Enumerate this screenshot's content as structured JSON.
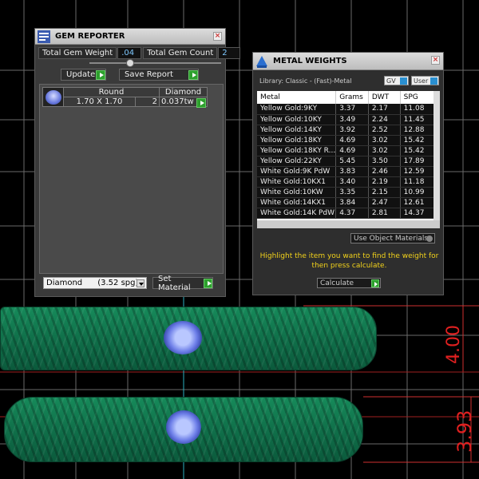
{
  "gem_reporter": {
    "title": "GEM REPORTER",
    "close_glyph": "×",
    "total_weight_label": "Total Gem Weight",
    "total_weight_value": ".04",
    "total_count_label": "Total Gem Count",
    "total_count_value": "2",
    "update_label": "Update",
    "save_report_label": "Save Report",
    "table": {
      "headers": [
        "Round",
        "Diamond"
      ],
      "row": {
        "size": "1.70 X 1.70",
        "count": "2",
        "weight": "0.037tw"
      }
    },
    "material_select": "Diamond      (3.52 spg)",
    "set_material_label": "Set Material"
  },
  "metal_weights": {
    "title": "METAL WEIGHTS",
    "close_glyph": "×",
    "library_text": "Library: Classic - (Fast)-Metal",
    "toggle_gv": "GV",
    "toggle_user": "User",
    "columns": [
      "Metal",
      "Grams",
      "DWT",
      "SPG"
    ],
    "rows": [
      [
        "Yellow Gold:9KY",
        "3.37",
        "2.17",
        "11.08"
      ],
      [
        "Yellow Gold:10KY",
        "3.49",
        "2.24",
        "11.45"
      ],
      [
        "Yellow Gold:14KY",
        "3.92",
        "2.52",
        "12.88"
      ],
      [
        "Yellow Gold:18KY",
        "4.69",
        "3.02",
        "15.42"
      ],
      [
        "Yellow Gold:18KY R...",
        "4.69",
        "3.02",
        "15.42"
      ],
      [
        "Yellow Gold:22KY",
        "5.45",
        "3.50",
        "17.89"
      ],
      [
        "White Gold:9K PdW",
        "3.83",
        "2.46",
        "12.59"
      ],
      [
        "White Gold:10KX1",
        "3.40",
        "2.19",
        "11.18"
      ],
      [
        "White Gold:10KW",
        "3.35",
        "2.15",
        "10.99"
      ],
      [
        "White Gold:14KX1",
        "3.84",
        "2.47",
        "12.61"
      ],
      [
        "White Gold:14K PdW",
        "4.37",
        "2.81",
        "14.37"
      ]
    ],
    "use_object_materials": "Use Object Materials",
    "hint": "Highlight the item you want to find the weight for then press calculate.",
    "calculate_label": "Calculate"
  },
  "viewport": {
    "dimension_top": "4.00",
    "dimension_bottom": "3.93",
    "colors": {
      "ring": "#10704a",
      "dimension": "#e02020",
      "grid": "#6a6a6a"
    }
  }
}
